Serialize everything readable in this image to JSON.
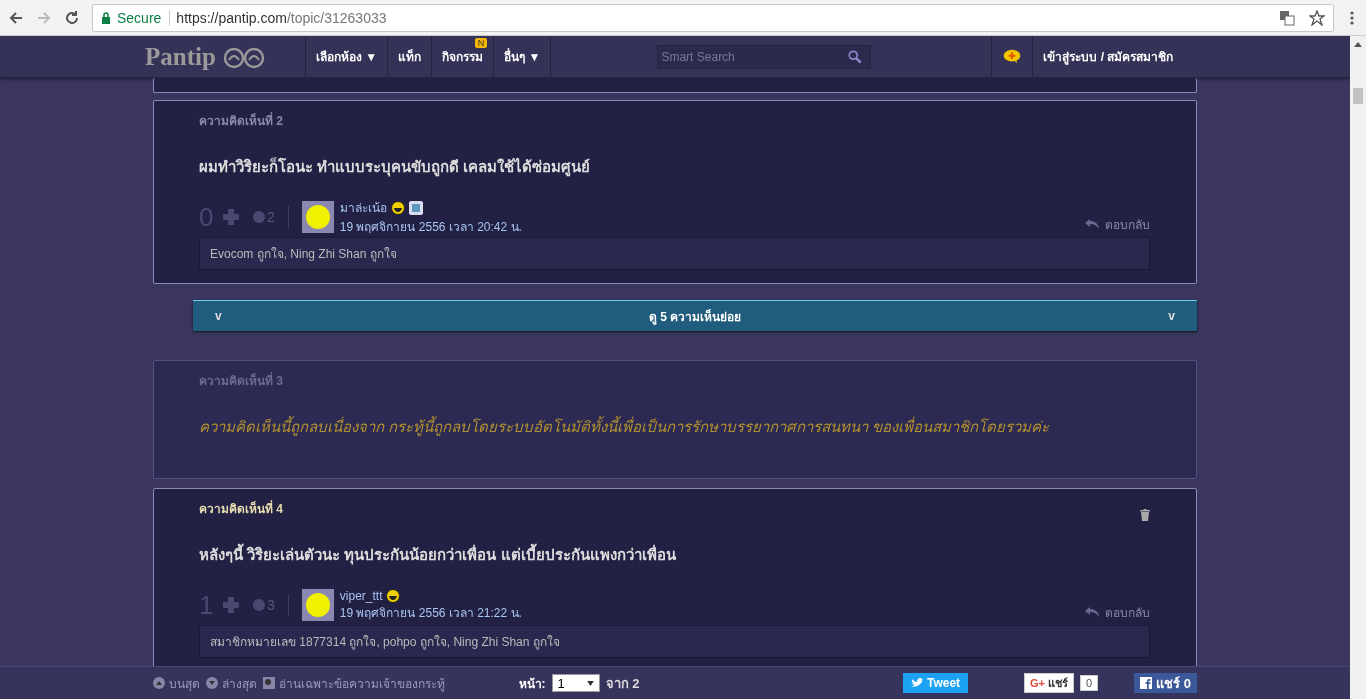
{
  "browser": {
    "secure_label": "Secure",
    "url_host": "https://pantip.com",
    "url_path": "/topic/31263033"
  },
  "nav": {
    "logo": "Pantip",
    "menu": [
      {
        "label": "เลือกห้อง ▼"
      },
      {
        "label": "แท็ก"
      },
      {
        "label": "กิจกรรม",
        "badge": "N"
      },
      {
        "label": "อื่นๆ ▼"
      }
    ],
    "search_placeholder": "Smart Search",
    "login": "เข้าสู่ระบบ / สมัครสมาชิก"
  },
  "comments": [
    {
      "kind": "normal",
      "title": "ความคิดเห็นที่ 2",
      "deletable": false,
      "body": "ผมทำวิริยะก็โอนะ ทำแบบระบุคนขับถูกดี เคลมใช้ได้ซ่อมศูนย์",
      "score": "0",
      "emotions": "2",
      "user": "มาล่ะเน้อ",
      "blog_badge": true,
      "date": "19 พฤศจิกายน 2556 เวลา 20:42 น.",
      "reply": "ตอบกลับ",
      "likes": "Evocom ถูกใจ, Ning Zhi Shan ถูกใจ",
      "expand": {
        "label": "ดู 5 ความเห็นย่อย",
        "left": "v",
        "right": "v"
      }
    },
    {
      "kind": "deleted",
      "title": "ความคิดเห็นที่ 3",
      "message": "ความคิดเห็นนี้ถูกลบเนื่องจาก กระทู้นี้ถูกลบโดยระบบอัตโนมัติทั้งนี้เพื่อเป็นการรักษาบรรยากาศการสนทนา ของเพื่อนสมาชิกโดยรวมค่ะ"
    },
    {
      "kind": "normal",
      "title": "ความคิดเห็นที่ 4",
      "deletable": true,
      "body": "หลังๆนี้ วิริยะเล่นตัวนะ ทุนประกันน้อยกว่าเพื่อน แต่เบี้ยประกันแพงกว่าเพื่อน",
      "score": "1",
      "emotions": "3",
      "user": "viper_ttt",
      "blog_badge": false,
      "date": "19 พฤศจิกายน 2556 เวลา 21:22 น.",
      "reply": "ตอบกลับ",
      "likes": "สมาชิกหมายเลข 1877314 ถูกใจ, pohpo ถูกใจ, Ning Zhi Shan ถูกใจ"
    }
  ],
  "footer": {
    "top": "บนสุด",
    "bottom": "ล่างสุด",
    "owner_only": "อ่านเฉพาะข้อความเจ้าของกระทู้",
    "page_label": "หน้า:",
    "page": "1",
    "of": "จาก 2",
    "tweet": "Tweet",
    "gplus_icon": "G+",
    "gplus": "แชร์",
    "gplus_count": "0",
    "fb": "แชร์ 0"
  }
}
